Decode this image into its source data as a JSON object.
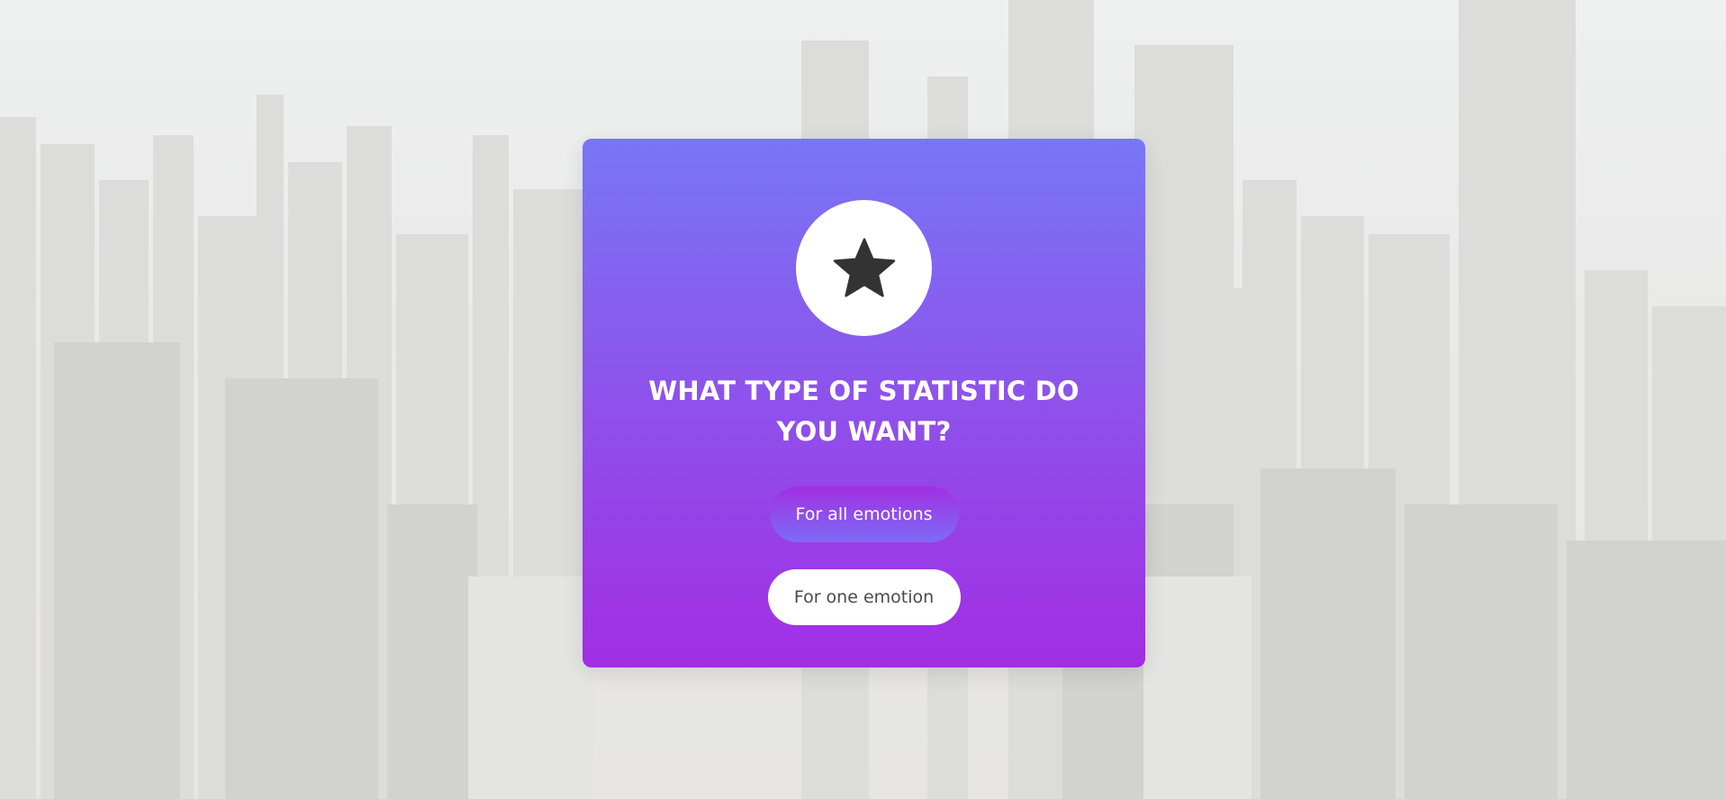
{
  "modal": {
    "icon": "star-icon",
    "title": "WHAT TYPE OF STATISTIC DO YOU WANT?",
    "buttons": {
      "all_emotions_label": "For all emotions",
      "one_emotion_label": "For one emotion"
    }
  },
  "colors": {
    "card_gradient_top": "#7876f5",
    "card_gradient_bottom": "#a22ee4",
    "icon_color": "#333333",
    "title_color": "#ffffff"
  }
}
